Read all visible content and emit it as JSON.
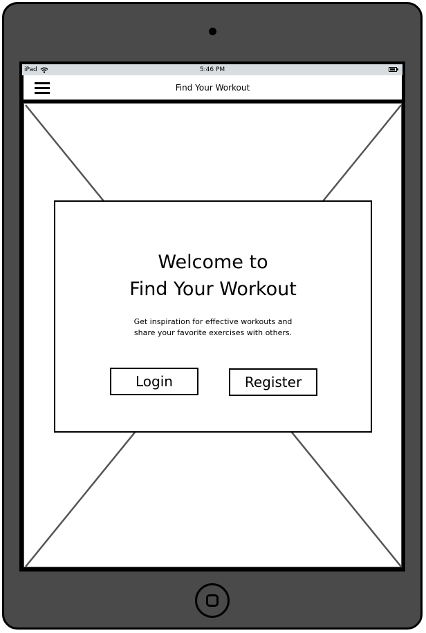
{
  "status_bar": {
    "device": "iPad",
    "time": "5:46 PM"
  },
  "nav": {
    "title": "Find Your Workout",
    "menu_icon": "hamburger-menu-icon"
  },
  "welcome": {
    "line1": "Welcome to",
    "line2": "Find Your Workout",
    "desc_line1": "Get inspiration for effective workouts and",
    "desc_line2": "share your favorite exercises with others."
  },
  "buttons": {
    "login": "Login",
    "register": "Register"
  }
}
